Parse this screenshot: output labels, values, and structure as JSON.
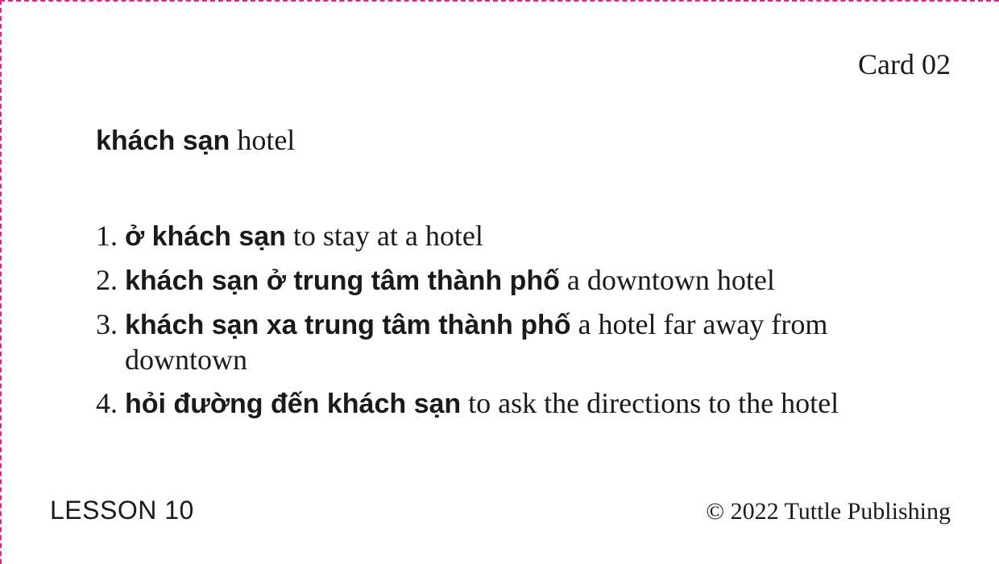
{
  "card": {
    "number_label": "Card 02",
    "border_color": "#e0228f"
  },
  "headword": {
    "vietnamese": "khách sạn",
    "english": "hotel"
  },
  "examples": [
    {
      "number": "1.",
      "vietnamese": "ở khách sạn",
      "english": "to stay at a hotel"
    },
    {
      "number": "2.",
      "vietnamese": "khách sạn ở trung tâm thành phố",
      "english": "a downtown hotel"
    },
    {
      "number": "3.",
      "vietnamese": "khách sạn xa trung tâm thành phố",
      "english": "a hotel far away from downtown"
    },
    {
      "number": "4.",
      "vietnamese": "hỏi đường đến khách sạn",
      "english": "to ask the directions to the hotel"
    }
  ],
  "footer": {
    "lesson": "LESSON 10",
    "copyright": "© 2022 Tuttle Publishing"
  }
}
